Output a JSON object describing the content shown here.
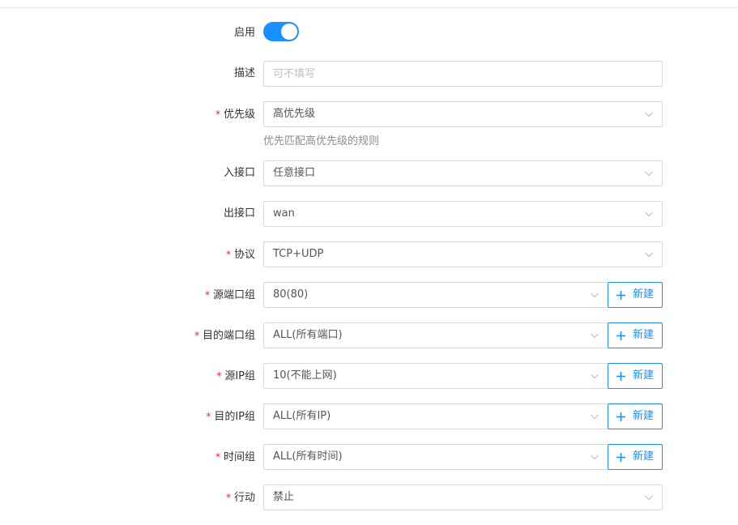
{
  "form": {
    "enabled": {
      "label": "启用",
      "value": true
    },
    "description": {
      "label": "描述",
      "placeholder": "可不填写"
    },
    "priority": {
      "label": "优先级",
      "required": true,
      "value": "高优先级",
      "hint": "优先匹配高优先级的规则"
    },
    "in_interface": {
      "label": "入接口",
      "value": "任意接口"
    },
    "out_interface": {
      "label": "出接口",
      "value": "wan"
    },
    "protocol": {
      "label": "协议",
      "required": true,
      "value": "TCP+UDP"
    },
    "src_port_group": {
      "label": "源端口组",
      "required": true,
      "value": "80(80)",
      "new_label": "新建"
    },
    "dst_port_group": {
      "label": "目的端口组",
      "required": true,
      "value": "ALL(所有端口)",
      "new_label": "新建"
    },
    "src_ip_group": {
      "label": "源IP组",
      "required": true,
      "value": "10(不能上网)",
      "new_label": "新建"
    },
    "dst_ip_group": {
      "label": "目的IP组",
      "required": true,
      "value": "ALL(所有IP)",
      "new_label": "新建"
    },
    "time_group": {
      "label": "时间组",
      "required": true,
      "value": "ALL(所有时间)",
      "new_label": "新建"
    },
    "action": {
      "label": "行动",
      "required": true,
      "value": "禁止"
    }
  },
  "colors": {
    "accent": "#1890ff",
    "required": "#f5222d",
    "border": "#d9d9d9"
  },
  "icons": {
    "select_arrow": "chevron-down-icon",
    "new": "plus-icon"
  }
}
